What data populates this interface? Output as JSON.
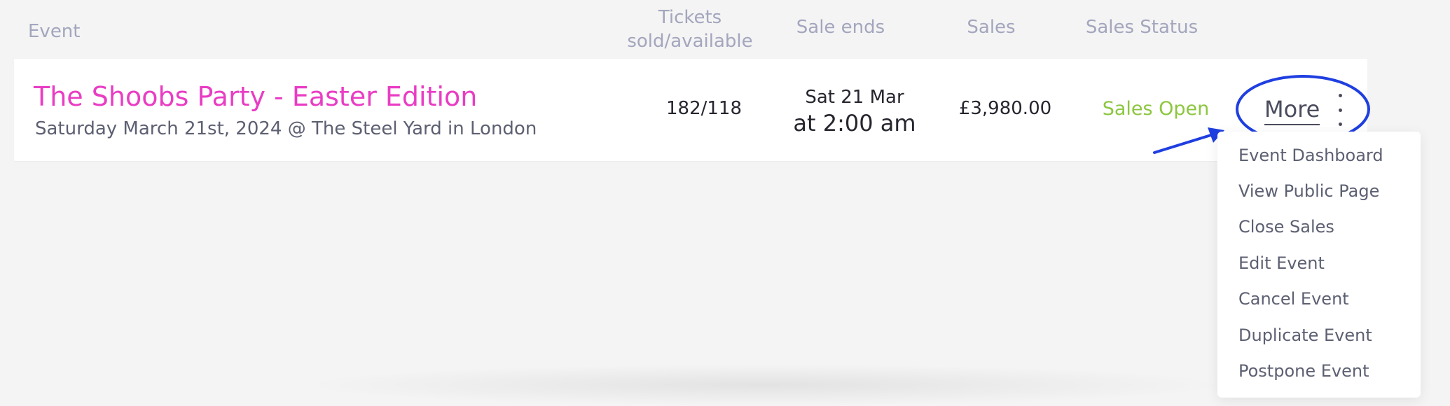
{
  "table": {
    "headers": {
      "event": "Event",
      "tickets_line1": "Tickets",
      "tickets_line2": "sold/available",
      "sale_ends": "Sale ends",
      "sales": "Sales",
      "sales_status": "Sales Status"
    },
    "row": {
      "title": "The Shoobs Party - Easter Edition",
      "subtitle": "Saturday March 21st, 2024 @ The Steel Yard in London",
      "tickets": "182/118",
      "sale_ends_date": "Sat 21 Mar",
      "sale_ends_time": "at 2:00 am",
      "sales": "£3,980.00",
      "status": "Sales Open",
      "more_label": "More"
    }
  },
  "menu": {
    "items": [
      "Event Dashboard",
      "View Public Page",
      "Close Sales",
      "Edit Event",
      "Cancel Event",
      "Duplicate Event",
      "Postpone Event"
    ]
  },
  "colors": {
    "title": "#e93dc4",
    "status_open": "#8cc63f",
    "annotation": "#1f3fe0",
    "header_text": "#a3a6bd"
  },
  "icons": {
    "kebab": "vertical-ellipsis-icon"
  }
}
